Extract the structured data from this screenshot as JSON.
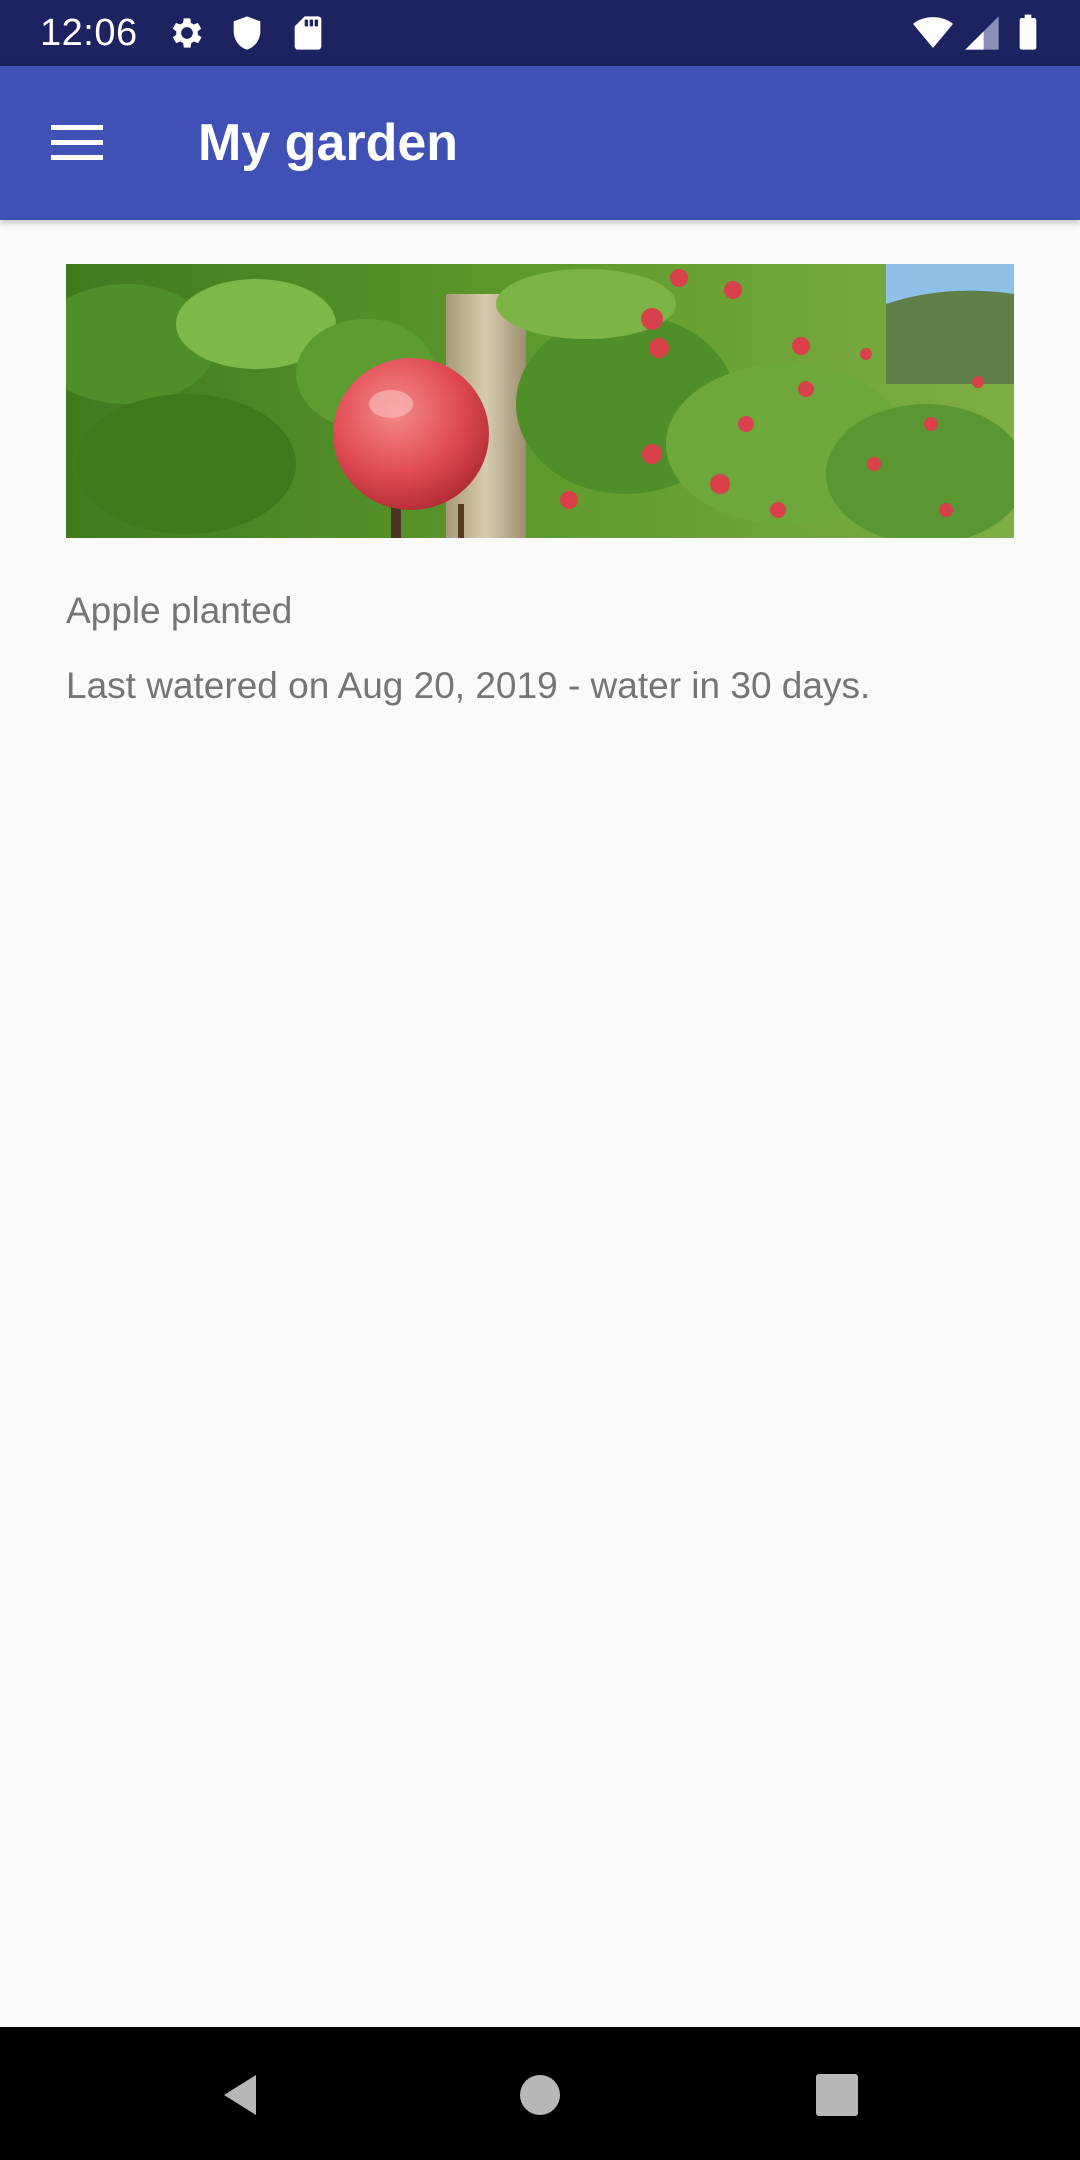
{
  "status_bar": {
    "time": "12:06",
    "icons": [
      "settings-icon",
      "shield-icon",
      "sd-card-icon",
      "wifi-icon",
      "signal-icon",
      "battery-icon"
    ]
  },
  "app_bar": {
    "title": "My garden",
    "menu_icon": "menu-icon"
  },
  "plant": {
    "name": "Apple planted",
    "watering": "Last watered on Aug 20, 2019 - water in 30 days."
  },
  "nav_bar": {
    "icons": [
      "back-icon",
      "home-icon",
      "recents-icon"
    ]
  },
  "colors": {
    "status_bar": "#1c2360",
    "app_bar": "#3f51b5",
    "background": "#fafafa",
    "text_secondary": "#757575"
  }
}
